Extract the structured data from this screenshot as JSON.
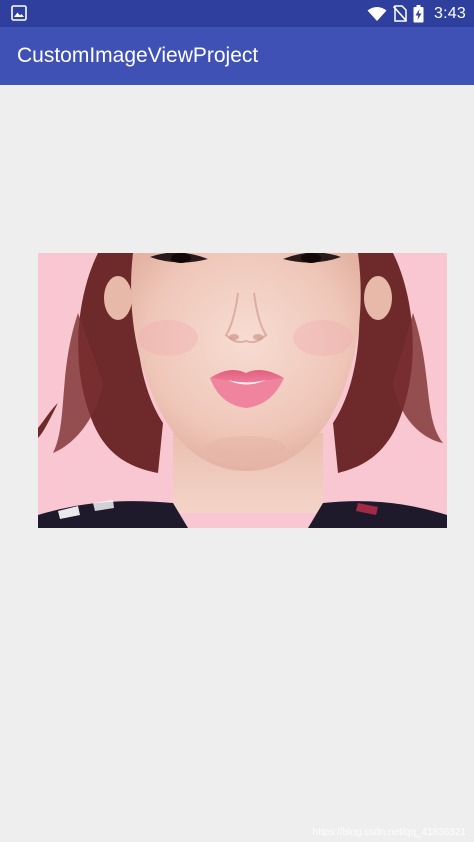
{
  "status_bar": {
    "time": "3:43",
    "icons": [
      "image-notification-icon",
      "wifi-icon",
      "no-sim-icon",
      "battery-charging-icon"
    ]
  },
  "app_bar": {
    "title": "CustomImageViewProject"
  },
  "content": {
    "image": {
      "description_icon": "portrait-photo",
      "watermark": "https://blog.csdn.net/qq_41836321"
    }
  },
  "colors": {
    "status_bar": "#2F3F9E",
    "app_bar": "#3F51B5",
    "background": "#EEEEEE",
    "photo_background": "#F9C7D2"
  }
}
